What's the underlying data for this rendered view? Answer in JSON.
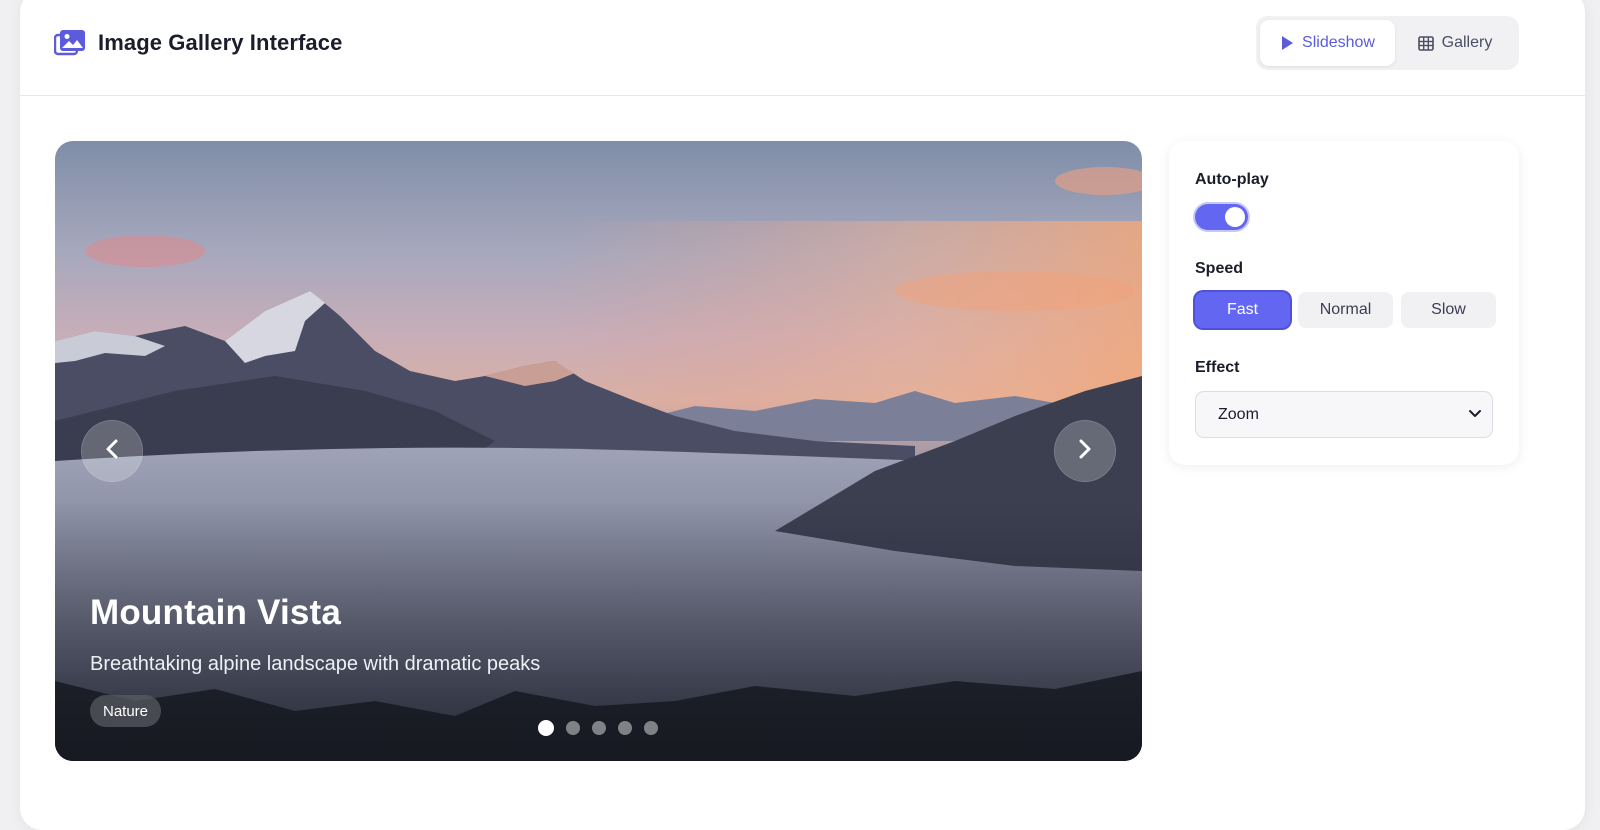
{
  "header": {
    "title": "Image Gallery Interface",
    "logo_icon": "images-icon",
    "view_tabs": [
      {
        "label": "Slideshow",
        "icon": "play-icon",
        "active": true
      },
      {
        "label": "Gallery",
        "icon": "grid-icon",
        "active": false
      }
    ]
  },
  "slide": {
    "title": "Mountain Vista",
    "description": "Breathtaking alpine landscape with dramatic peaks",
    "tag": "Nature",
    "current_index": 1,
    "total": 5
  },
  "settings": {
    "autoplay_label": "Auto-play",
    "autoplay_on": true,
    "speed_label": "Speed",
    "speed_options": [
      "Fast",
      "Normal",
      "Slow"
    ],
    "speed_selected": "Fast",
    "effect_label": "Effect",
    "effect_value": "Zoom"
  },
  "colors": {
    "accent": "#6366f1",
    "text": "#1b1d2b"
  }
}
